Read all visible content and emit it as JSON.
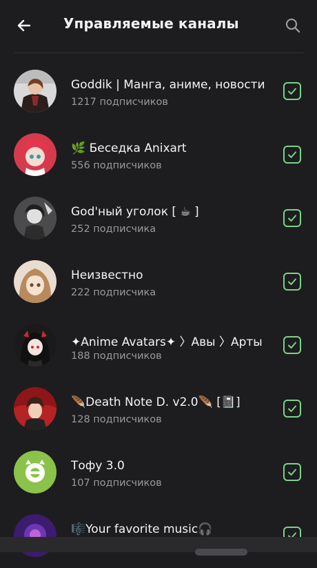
{
  "header": {
    "title": "Управляемые каналы",
    "back_icon": "arrow-left-icon",
    "search_icon": "search-icon"
  },
  "colors": {
    "background": "#1d1d1f",
    "accent_check": "#7bd389",
    "secondary_text": "#9a9a9e"
  },
  "channels": [
    {
      "name": "Goddik | Манга, аниме, новости",
      "subscribers": "1217 подписчиков",
      "checked": true
    },
    {
      "name": "🌿 Беседка Anixart",
      "subscribers": "556 подписчиков",
      "checked": true
    },
    {
      "name": "God'ный уголок [ ☕ ]",
      "subscribers": "252 подписчика",
      "checked": true
    },
    {
      "name": "Неизвестно",
      "subscribers": "222 подписчика",
      "checked": true
    },
    {
      "name": "✦Anime Avatars✦ 〉Авы 〉Арты",
      "subscribers": "188 подписчиков",
      "checked": true
    },
    {
      "name": "🪶Death Note D. v2.0🪶 [📓]",
      "subscribers": "128 подписчиков",
      "checked": true
    },
    {
      "name": "Тофу 3.0",
      "subscribers": "107 подписчиков",
      "checked": true
    },
    {
      "name": "🎼Your favorite music🎧",
      "subscribers": "",
      "checked": true
    }
  ]
}
